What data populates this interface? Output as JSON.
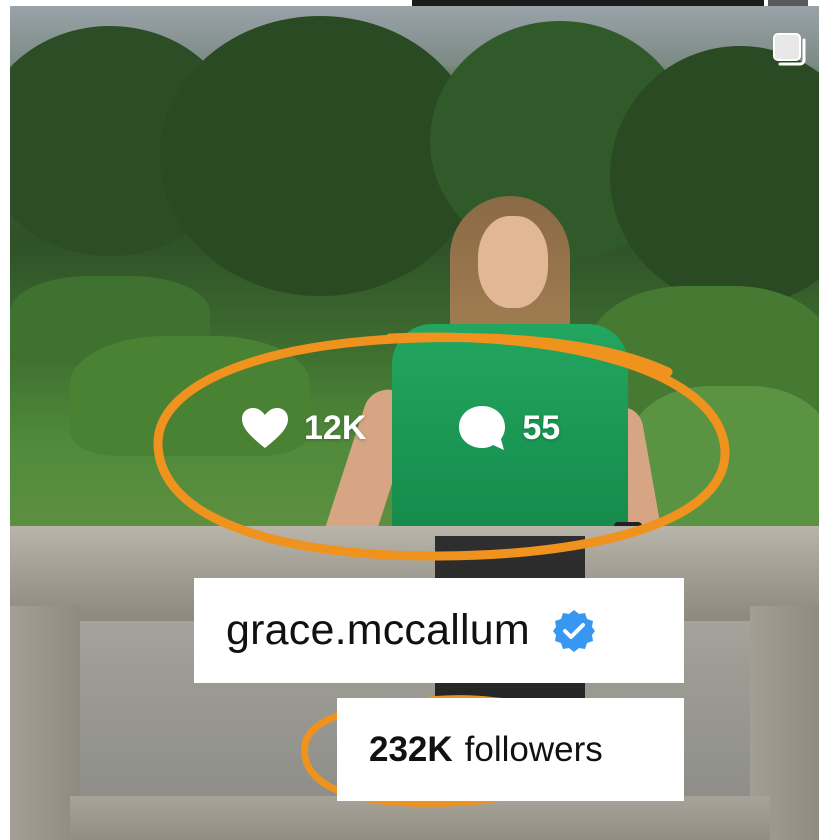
{
  "post_overlay": {
    "likes": "12K",
    "comments": "55"
  },
  "profile": {
    "username": "grace.mccallum",
    "verified": true,
    "followers_count": "232K",
    "followers_label": "followers"
  },
  "icons": {
    "likes": "heart-icon",
    "comments": "comment-bubble-icon",
    "verified": "verified-badge-icon",
    "carousel": "multiple-posts-icon"
  },
  "colors": {
    "annotation": "#f0921e",
    "verified_badge": "#3897f0",
    "card_background": "#ffffff",
    "text": "#111111"
  }
}
